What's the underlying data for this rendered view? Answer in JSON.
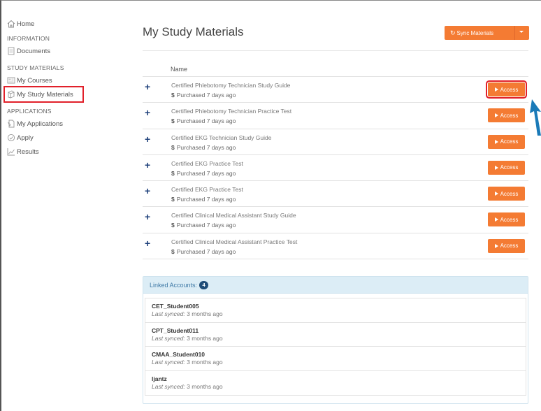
{
  "sidebar": {
    "home": "Home",
    "sections": [
      {
        "heading": "INFORMATION",
        "items": [
          {
            "label": "Documents",
            "icon": "document-icon"
          }
        ]
      },
      {
        "heading": "STUDY MATERIALS",
        "items": [
          {
            "label": "My Courses",
            "icon": "course-icon"
          },
          {
            "label": "My Study Materials",
            "icon": "book-icon"
          }
        ]
      },
      {
        "heading": "APPLICATIONS",
        "items": [
          {
            "label": "My Applications",
            "icon": "application-icon"
          },
          {
            "label": "Apply",
            "icon": "apply-icon"
          },
          {
            "label": "Results",
            "icon": "results-icon"
          }
        ]
      }
    ]
  },
  "main": {
    "title": "My Study Materials",
    "sync_label": "Sync Materials",
    "column_name": "Name",
    "rows": [
      {
        "title": "Certified Phlebotomy Technician Study Guide",
        "purchase": "Purchased 7 days ago",
        "access": "Access"
      },
      {
        "title": "Certified Phlebotomy Technician Practice Test",
        "purchase": "Purchased 7 days ago",
        "access": "Access"
      },
      {
        "title": "Certified EKG Technician Study Guide",
        "purchase": "Purchased 7 days ago",
        "access": "Access"
      },
      {
        "title": "Certified EKG Practice Test",
        "purchase": "Purchased 7 days ago",
        "access": "Access"
      },
      {
        "title": "Certified EKG Practice Test",
        "purchase": "Purchased 7 days ago",
        "access": "Access"
      },
      {
        "title": "Certified Clinical Medical Assistant Study Guide",
        "purchase": "Purchased 7 days ago",
        "access": "Access"
      },
      {
        "title": "Certified Clinical Medical Assistant Practice Test",
        "purchase": "Purchased 7 days ago",
        "access": "Access"
      }
    ],
    "dollar": "$"
  },
  "linked": {
    "heading": "Linked Accounts:",
    "count": "4",
    "synced_label": "Last synced:",
    "accounts": [
      {
        "name": "CET_Student005",
        "synced": "3 months ago"
      },
      {
        "name": "CPT_Student011",
        "synced": "3 months ago"
      },
      {
        "name": "CMAA_Student010",
        "synced": "3 months ago"
      },
      {
        "name": "ljantz",
        "synced": "3 months ago"
      }
    ]
  },
  "colors": {
    "accent": "#f47b33",
    "highlight": "#e1202a",
    "badge": "#1f4d78",
    "panel": "#dcedf6",
    "arrow": "#1a7ab8"
  }
}
